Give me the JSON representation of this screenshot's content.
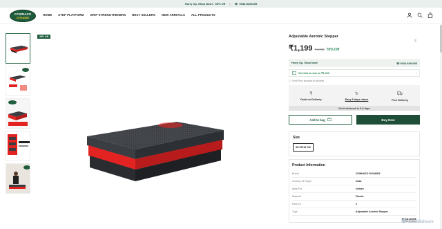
{
  "announcement": {
    "text": "Hurry Up, Shop Now! - 50% Off",
    "phone": "0034-5294195"
  },
  "logo": {
    "line1": "GYMNAZO",
    "line2": "DYNAMIZ"
  },
  "nav": [
    "HOME",
    "STEP PLATFORM",
    "GRIP STRENGTHENERS",
    "BEST SELLERS",
    "NEW ARRIVALS",
    "ALL PRODUCTS"
  ],
  "header_icons": [
    "user-icon",
    "search-icon",
    "bag-icon"
  ],
  "badge": "35% Off",
  "product": {
    "title": "Adjustable Aerobic Stepper",
    "price": "₹1,199",
    "mrp": "₹4,799",
    "discount": "76% Off"
  },
  "hurry": {
    "text": "Hurry Up, Shop Now!",
    "phone": "0034-5294195"
  },
  "offer": {
    "text": "Get this as low as ₹1,020"
  },
  "tax_note": "Final Price inclusive of all taxes",
  "features": [
    {
      "icon": "rupee-icon",
      "label": "Cash on Delivery",
      "underline": false
    },
    {
      "icon": "return-icon",
      "label": "Easy 5 days return",
      "underline": true
    },
    {
      "icon": "truck-icon",
      "label": "Free Delivery",
      "underline": false
    }
  ],
  "delivery_note": "Get it delivered in 5-6 days",
  "buttons": {
    "add_to_bag": "Add to bag",
    "buy_now": "Buy Now"
  },
  "size": {
    "label": "Size",
    "selected": "68*28*15 CM"
  },
  "product_info": {
    "label": "Product Information",
    "rows": [
      {
        "k": "Brand",
        "v": "GYMNAZO DYNAMIZ"
      },
      {
        "k": "Country Of Origin",
        "v": "India"
      },
      {
        "k": "Ideal For",
        "v": "Unisex"
      },
      {
        "k": "Material",
        "v": "Plastic"
      },
      {
        "k": "Pack Of",
        "v": "1"
      },
      {
        "k": "Type",
        "v": "Adjustable Aerobic Stepper"
      }
    ],
    "read_more": "READ MORE"
  },
  "watermark": "ScanMalware",
  "colors": {
    "brand": "#1e5c3c",
    "accent_red": "#e32322",
    "step_dark": "#3a3d42"
  }
}
